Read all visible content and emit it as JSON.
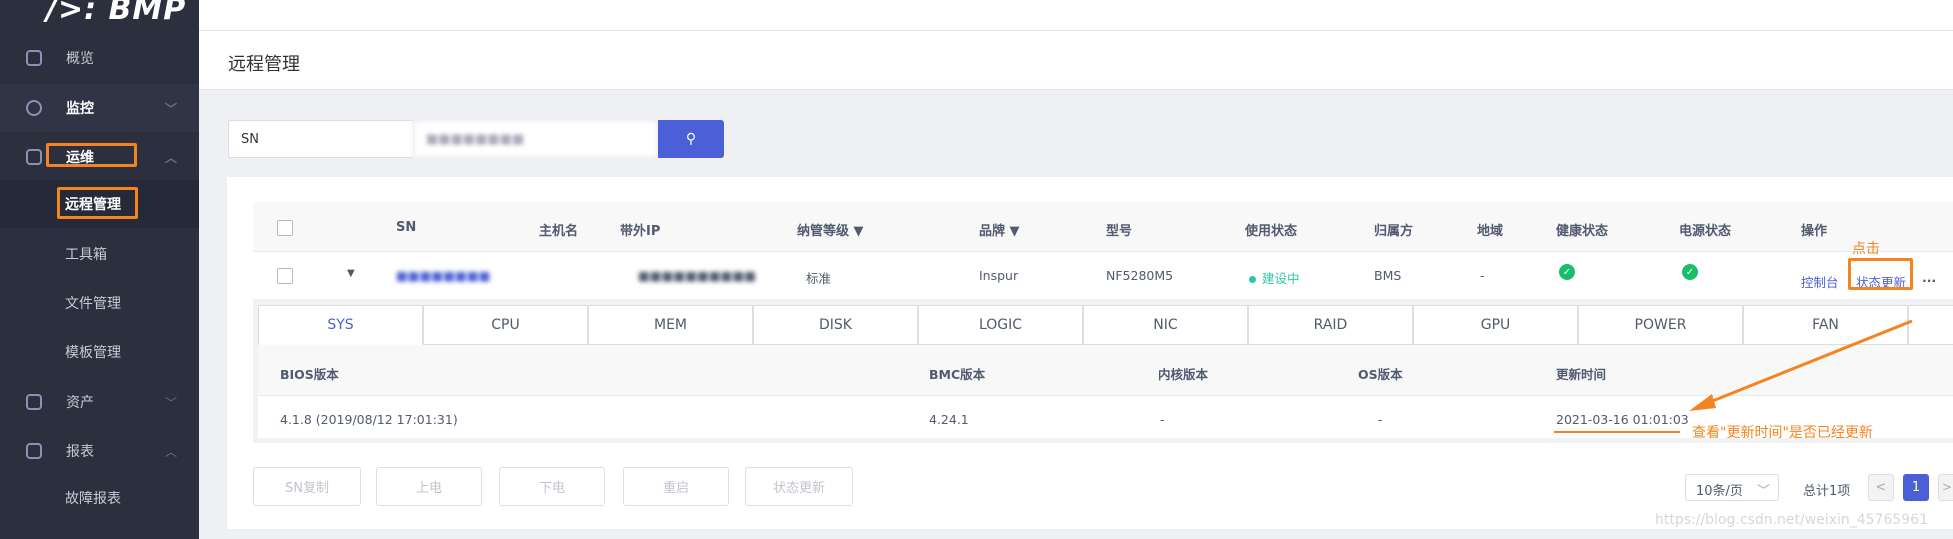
{
  "app": {
    "logo": "/>: BMP",
    "page_title": "远程管理"
  },
  "sidebar": {
    "items": [
      {
        "label": "概览",
        "icon": "dashboard-icon"
      },
      {
        "label": "监控",
        "icon": "monitor-icon"
      },
      {
        "label": "运维",
        "icon": "ops-icon"
      },
      {
        "label": "远程管理"
      },
      {
        "label": "工具箱"
      },
      {
        "label": "文件管理"
      },
      {
        "label": "模板管理"
      },
      {
        "label": "资产",
        "icon": "asset-icon"
      },
      {
        "label": "报表",
        "icon": "report-icon"
      },
      {
        "label": "故障报表"
      }
    ]
  },
  "search": {
    "field": "SN",
    "value": "■■■■■■■■",
    "button_icon": "search-icon"
  },
  "table": {
    "headers": [
      "SN",
      "主机名",
      "带外IP",
      "纳管等级",
      "品牌",
      "型号",
      "使用状态",
      "归属方",
      "地域",
      "健康状态",
      "电源状态",
      "操作"
    ],
    "row": {
      "sn": "■■■■■■■■",
      "hostname": "",
      "ip": "■■■■■■■■■■",
      "level": "标准",
      "brand": "Inspur",
      "model": "NF5280M5",
      "usage": "建设中",
      "owner": "BMS",
      "region": "-",
      "health": "ok",
      "power": "ok",
      "actions": [
        "控制台",
        "状态更新",
        "..."
      ]
    }
  },
  "detail": {
    "tabs": [
      "SYS",
      "CPU",
      "MEM",
      "DISK",
      "LOGIC",
      "NIC",
      "RAID",
      "GPU",
      "POWER",
      "FAN",
      ""
    ],
    "active_tab": "SYS",
    "headers": [
      "BIOS版本",
      "BMC版本",
      "内核版本",
      "OS版本",
      "更新时间"
    ],
    "values": [
      "4.1.8 (2019/08/12 17:01:31)",
      "4.24.1",
      "-",
      "-",
      "2021-03-16 01:01:03"
    ]
  },
  "bulk_buttons": [
    "SN复制",
    "上电",
    "下电",
    "重启",
    "状态更新"
  ],
  "pagination": {
    "page_size": "10条/页",
    "total": "总计1项",
    "current": "1"
  },
  "annotations": {
    "click": "点击",
    "note": "查看\"更新时间\"是否已经更新",
    "watermark": "https://blog.csdn.net/weixin_45765961"
  },
  "colors": {
    "accent": "#4b5fd6",
    "annotation": "#f4841f",
    "success": "#19be6b",
    "sidebar": "#2b2f3e"
  }
}
